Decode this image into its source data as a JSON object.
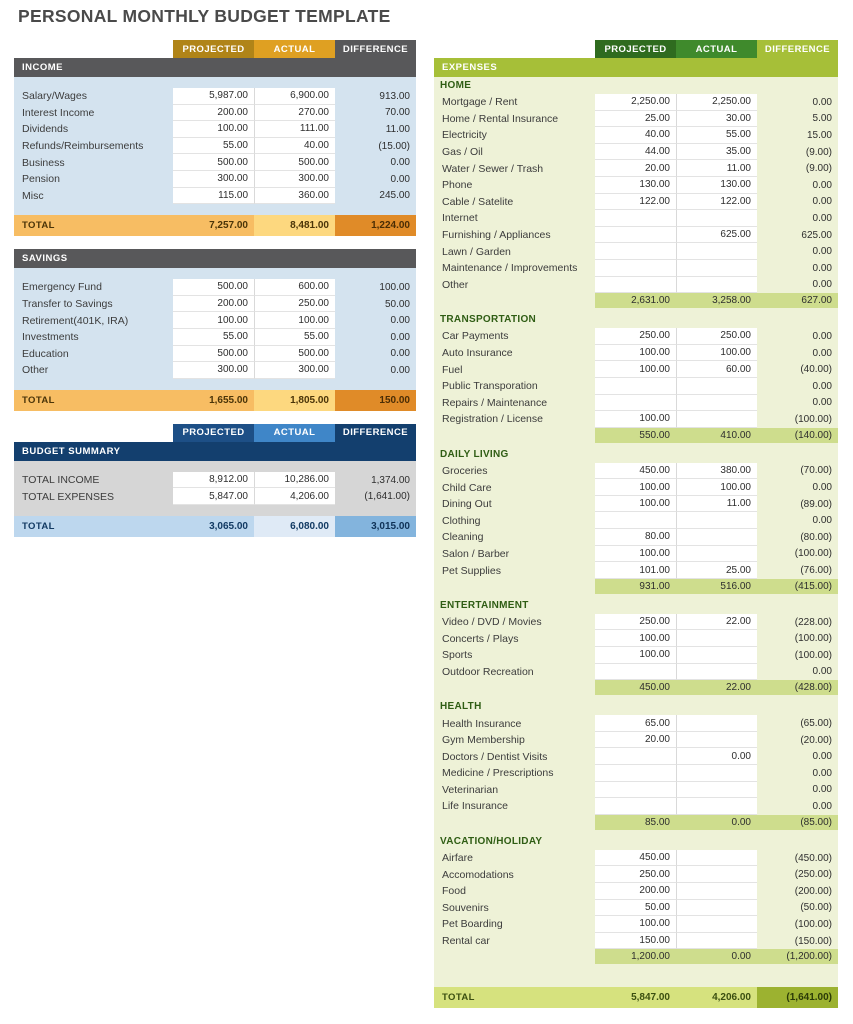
{
  "page": {
    "title": "PERSONAL MONTHLY BUDGET TEMPLATE"
  },
  "columns": {
    "projected": "PROJECTED",
    "actual": "ACTUAL",
    "difference": "DIFFERENCE"
  },
  "colors": {
    "gold_projected": "#b08418",
    "gold_actual": "#dfa022",
    "gray_banner": "#58585a",
    "income_body": "#d4e3ef",
    "blue_projected": "#1d4f86",
    "blue_actual": "#3f86c8",
    "blue_banner": "#133f6e",
    "summary_body": "#d6d6d6",
    "green_projected": "#2f6b1f",
    "green_actual": "#3f8a2c",
    "green_banner": "#a6bf38",
    "expense_body": "#eef2d7",
    "subtotal_strip": "#cedd8d"
  },
  "income": {
    "banner": "INCOME",
    "rows": [
      {
        "label": "Salary/Wages",
        "projected": "5,987.00",
        "actual": "6,900.00",
        "difference": "913.00"
      },
      {
        "label": "Interest Income",
        "projected": "200.00",
        "actual": "270.00",
        "difference": "70.00"
      },
      {
        "label": "Dividends",
        "projected": "100.00",
        "actual": "111.00",
        "difference": "11.00"
      },
      {
        "label": "Refunds/Reimbursements",
        "projected": "55.00",
        "actual": "40.00",
        "difference": "(15.00)"
      },
      {
        "label": "Business",
        "projected": "500.00",
        "actual": "500.00",
        "difference": "0.00"
      },
      {
        "label": "Pension",
        "projected": "300.00",
        "actual": "300.00",
        "difference": "0.00"
      },
      {
        "label": "Misc",
        "projected": "115.00",
        "actual": "360.00",
        "difference": "245.00"
      }
    ],
    "total": {
      "label": "TOTAL",
      "projected": "7,257.00",
      "actual": "8,481.00",
      "difference": "1,224.00"
    }
  },
  "savings": {
    "banner": "SAVINGS",
    "rows": [
      {
        "label": "Emergency Fund",
        "projected": "500.00",
        "actual": "600.00",
        "difference": "100.00"
      },
      {
        "label": "Transfer to Savings",
        "projected": "200.00",
        "actual": "250.00",
        "difference": "50.00"
      },
      {
        "label": "Retirement(401K, IRA)",
        "projected": "100.00",
        "actual": "100.00",
        "difference": "0.00"
      },
      {
        "label": "Investments",
        "projected": "55.00",
        "actual": "55.00",
        "difference": "0.00"
      },
      {
        "label": "Education",
        "projected": "500.00",
        "actual": "500.00",
        "difference": "0.00"
      },
      {
        "label": "Other",
        "projected": "300.00",
        "actual": "300.00",
        "difference": "0.00"
      }
    ],
    "total": {
      "label": "TOTAL",
      "projected": "1,655.00",
      "actual": "1,805.00",
      "difference": "150.00"
    }
  },
  "summary": {
    "banner": "BUDGET SUMMARY",
    "rows": [
      {
        "label": "TOTAL INCOME",
        "projected": "8,912.00",
        "actual": "10,286.00",
        "difference": "1,374.00"
      },
      {
        "label": "TOTAL EXPENSES",
        "projected": "5,847.00",
        "actual": "4,206.00",
        "difference": "(1,641.00)"
      }
    ],
    "total": {
      "label": "TOTAL",
      "projected": "3,065.00",
      "actual": "6,080.00",
      "difference": "3,015.00"
    }
  },
  "expenses": {
    "banner": "EXPENSES",
    "sections": [
      {
        "name": "HOME",
        "rows": [
          {
            "label": "Mortgage / Rent",
            "projected": "2,250.00",
            "actual": "2,250.00",
            "difference": "0.00"
          },
          {
            "label": "Home / Rental Insurance",
            "projected": "25.00",
            "actual": "30.00",
            "difference": "5.00"
          },
          {
            "label": "Electricity",
            "projected": "40.00",
            "actual": "55.00",
            "difference": "15.00"
          },
          {
            "label": "Gas / Oil",
            "projected": "44.00",
            "actual": "35.00",
            "difference": "(9.00)"
          },
          {
            "label": "Water / Sewer / Trash",
            "projected": "20.00",
            "actual": "11.00",
            "difference": "(9.00)"
          },
          {
            "label": "Phone",
            "projected": "130.00",
            "actual": "130.00",
            "difference": "0.00"
          },
          {
            "label": "Cable / Satelite",
            "projected": "122.00",
            "actual": "122.00",
            "difference": "0.00"
          },
          {
            "label": "Internet",
            "projected": "",
            "actual": "",
            "difference": "0.00"
          },
          {
            "label": "Furnishing / Appliances",
            "projected": "",
            "actual": "625.00",
            "difference": "625.00"
          },
          {
            "label": "Lawn / Garden",
            "projected": "",
            "actual": "",
            "difference": "0.00"
          },
          {
            "label": "Maintenance / Improvements",
            "projected": "",
            "actual": "",
            "difference": "0.00"
          },
          {
            "label": "Other",
            "projected": "",
            "actual": "",
            "difference": "0.00"
          }
        ],
        "subtotal": {
          "projected": "2,631.00",
          "actual": "3,258.00",
          "difference": "627.00"
        }
      },
      {
        "name": "TRANSPORTATION",
        "rows": [
          {
            "label": "Car Payments",
            "projected": "250.00",
            "actual": "250.00",
            "difference": "0.00"
          },
          {
            "label": "Auto Insurance",
            "projected": "100.00",
            "actual": "100.00",
            "difference": "0.00"
          },
          {
            "label": "Fuel",
            "projected": "100.00",
            "actual": "60.00",
            "difference": "(40.00)"
          },
          {
            "label": "Public Transporation",
            "projected": "",
            "actual": "",
            "difference": "0.00"
          },
          {
            "label": "Repairs / Maintenance",
            "projected": "",
            "actual": "",
            "difference": "0.00"
          },
          {
            "label": "Registration / License",
            "projected": "100.00",
            "actual": "",
            "difference": "(100.00)"
          }
        ],
        "subtotal": {
          "projected": "550.00",
          "actual": "410.00",
          "difference": "(140.00)"
        }
      },
      {
        "name": "DAILY LIVING",
        "rows": [
          {
            "label": "Groceries",
            "projected": "450.00",
            "actual": "380.00",
            "difference": "(70.00)"
          },
          {
            "label": "Child Care",
            "projected": "100.00",
            "actual": "100.00",
            "difference": "0.00"
          },
          {
            "label": "Dining Out",
            "projected": "100.00",
            "actual": "11.00",
            "difference": "(89.00)"
          },
          {
            "label": "Clothing",
            "projected": "",
            "actual": "",
            "difference": "0.00"
          },
          {
            "label": "Cleaning",
            "projected": "80.00",
            "actual": "",
            "difference": "(80.00)"
          },
          {
            "label": "Salon / Barber",
            "projected": "100.00",
            "actual": "",
            "difference": "(100.00)"
          },
          {
            "label": "Pet Supplies",
            "projected": "101.00",
            "actual": "25.00",
            "difference": "(76.00)"
          }
        ],
        "subtotal": {
          "projected": "931.00",
          "actual": "516.00",
          "difference": "(415.00)"
        }
      },
      {
        "name": "ENTERTAINMENT",
        "rows": [
          {
            "label": "Video / DVD / Movies",
            "projected": "250.00",
            "actual": "22.00",
            "difference": "(228.00)"
          },
          {
            "label": "Concerts / Plays",
            "projected": "100.00",
            "actual": "",
            "difference": "(100.00)"
          },
          {
            "label": "Sports",
            "projected": "100.00",
            "actual": "",
            "difference": "(100.00)"
          },
          {
            "label": "Outdoor Recreation",
            "projected": "",
            "actual": "",
            "difference": "0.00"
          }
        ],
        "subtotal": {
          "projected": "450.00",
          "actual": "22.00",
          "difference": "(428.00)"
        }
      },
      {
        "name": "HEALTH",
        "rows": [
          {
            "label": "Health Insurance",
            "projected": "65.00",
            "actual": "",
            "difference": "(65.00)"
          },
          {
            "label": "Gym Membership",
            "projected": "20.00",
            "actual": "",
            "difference": "(20.00)"
          },
          {
            "label": "Doctors / Dentist Visits",
            "projected": "",
            "actual": "0.00",
            "difference": "0.00"
          },
          {
            "label": "Medicine / Prescriptions",
            "projected": "",
            "actual": "",
            "difference": "0.00"
          },
          {
            "label": "Veterinarian",
            "projected": "",
            "actual": "",
            "difference": "0.00"
          },
          {
            "label": "Life Insurance",
            "projected": "",
            "actual": "",
            "difference": "0.00"
          }
        ],
        "subtotal": {
          "projected": "85.00",
          "actual": "0.00",
          "difference": "(85.00)"
        }
      },
      {
        "name": "VACATION/HOLIDAY",
        "rows": [
          {
            "label": "Airfare",
            "projected": "450.00",
            "actual": "",
            "difference": "(450.00)"
          },
          {
            "label": "Accomodations",
            "projected": "250.00",
            "actual": "",
            "difference": "(250.00)"
          },
          {
            "label": "Food",
            "projected": "200.00",
            "actual": "",
            "difference": "(200.00)"
          },
          {
            "label": "Souvenirs",
            "projected": "50.00",
            "actual": "",
            "difference": "(50.00)"
          },
          {
            "label": "Pet Boarding",
            "projected": "100.00",
            "actual": "",
            "difference": "(100.00)"
          },
          {
            "label": "Rental car",
            "projected": "150.00",
            "actual": "",
            "difference": "(150.00)"
          }
        ],
        "subtotal": {
          "projected": "1,200.00",
          "actual": "0.00",
          "difference": "(1,200.00)"
        }
      }
    ],
    "total": {
      "label": "TOTAL",
      "projected": "5,847.00",
      "actual": "4,206.00",
      "difference": "(1,641.00)"
    }
  }
}
